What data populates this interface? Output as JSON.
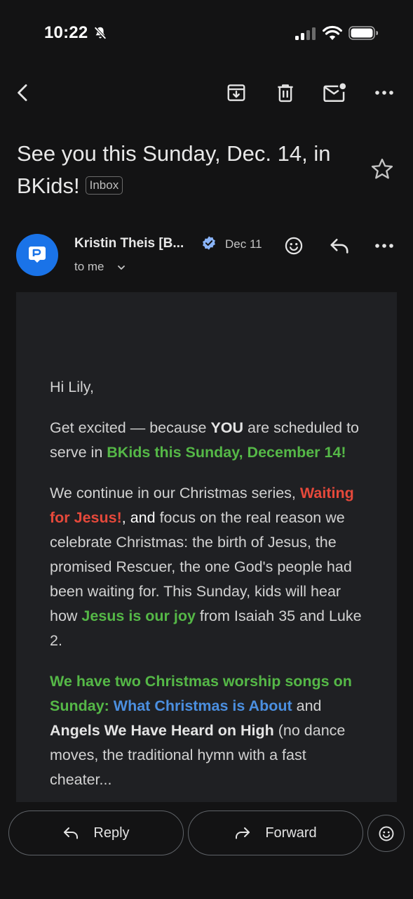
{
  "status_bar": {
    "time": "10:22",
    "icons": [
      "bell-slash-icon",
      "signal-icon",
      "wifi-icon",
      "battery-icon"
    ]
  },
  "toolbar": {
    "back": "back-arrow-icon",
    "actions": [
      "archive-icon",
      "trash-icon",
      "mark-unread-icon",
      "more-vertical-icon"
    ]
  },
  "email": {
    "subject": "See you this Sunday, Dec. 14, in BKids!",
    "label": "Inbox",
    "starred": false,
    "sender": {
      "name": "Kristin Theis [B...",
      "verified": true,
      "date": "Dec 11",
      "recipient": "to me"
    },
    "body": {
      "greeting": "Hi Lily,",
      "p1": {
        "a": "Get excited — because ",
        "b": "YOU",
        "c": " are scheduled to serve in ",
        "d": "BKids this Sunday, December 14!"
      },
      "p2": {
        "a": "We continue in our Christmas series, ",
        "b": "Waiting for Jesus!",
        "c": ", and",
        "d": " focus on the real reason we celebrate Christmas: the birth of Jesus, the promised Rescuer, the one God's people had been waiting for.  This Sunday, kids will hear how ",
        "e": "Jesus is our joy",
        "f": " from Isaiah 35 and Luke 2."
      },
      "p3": {
        "a": "We have two Christmas worship songs on Sunday:  ",
        "b": "What Christmas is About",
        "c": " and ",
        "d": "Angels We Have Heard on High",
        "e": " (no dance moves, the traditional hymn with a fast cheater...",
        "f": ""
      }
    }
  },
  "actions": {
    "reply_label": "Reply",
    "forward_label": "Forward"
  },
  "colors": {
    "background": "#131314",
    "body_background": "#1f2023",
    "green": "#55b847",
    "red": "#e6493b",
    "blue": "#4b8fe0",
    "avatar": "#1a73e8"
  }
}
